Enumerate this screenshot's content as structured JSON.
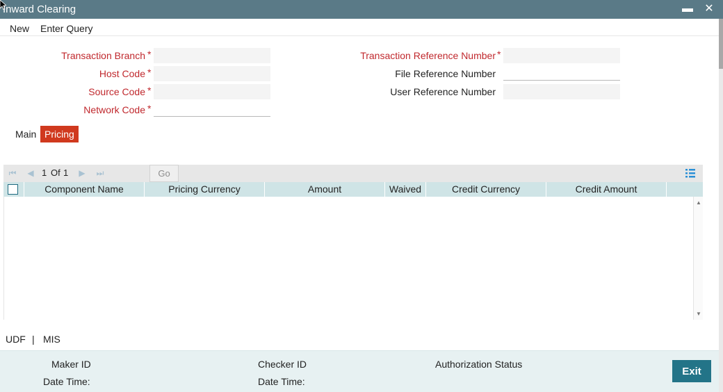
{
  "window": {
    "title": "Inward Clearing",
    "minimize_glyph": "▬",
    "close_glyph": "✕",
    "accent": "#5a7a87"
  },
  "menu": {
    "new_label": "New",
    "enter_query_label": "Enter Query"
  },
  "form": {
    "transaction_branch": {
      "label": "Transaction Branch",
      "value": ""
    },
    "host_code": {
      "label": "Host Code",
      "value": ""
    },
    "source_code": {
      "label": "Source Code",
      "value": ""
    },
    "network_code": {
      "label": "Network Code",
      "value": ""
    },
    "transaction_reference_number": {
      "label": "Transaction Reference Number",
      "value": ""
    },
    "file_reference_number": {
      "label": "File Reference Number",
      "value": ""
    },
    "user_reference_number": {
      "label": "User Reference Number",
      "value": ""
    },
    "required_marker": "*"
  },
  "tabs": {
    "main": "Main",
    "pricing": "Pricing",
    "active": "Pricing",
    "active_color": "#d0391e"
  },
  "grid": {
    "pager": {
      "current": "1",
      "of": "Of",
      "total": "1",
      "go_label": "Go"
    },
    "columns": [
      "Component Name",
      "Pricing Currency",
      "Amount",
      "Waived",
      "Credit Currency",
      "Credit Amount"
    ],
    "rows": [],
    "header_color": "#cfe4e6"
  },
  "links": {
    "udf": "UDF",
    "separator": "|",
    "mis": "MIS"
  },
  "footer": {
    "maker_id_label": "Maker ID",
    "date_time_label_1": "Date Time:",
    "checker_id_label": "Checker ID",
    "date_time_label_2": "Date Time:",
    "authorization_status_label": "Authorization Status",
    "exit_label": "Exit",
    "exit_color": "#237488"
  }
}
